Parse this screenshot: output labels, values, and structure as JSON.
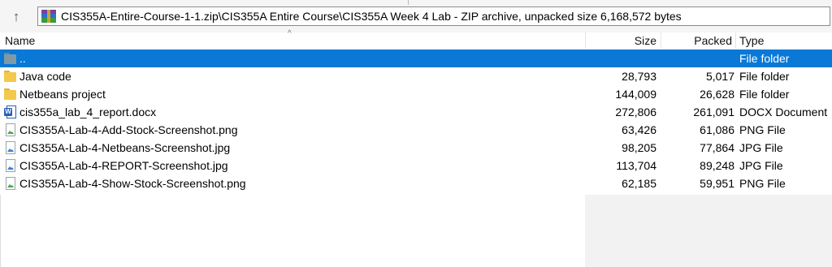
{
  "address": {
    "path": "CIS355A-Entire-Course-1-1.zip\\CIS355A Entire Course\\CIS355A Week 4 Lab - ZIP archive, unpacked size 6,168,572 bytes"
  },
  "toolbar": {
    "up_glyph": "↑"
  },
  "columns": {
    "name": "Name",
    "size": "Size",
    "packed": "Packed",
    "type": "Type"
  },
  "rows": [
    {
      "name": "..",
      "size": "",
      "packed": "",
      "type": "File folder",
      "icon": "up-folder-icon",
      "selected": true
    },
    {
      "name": "Java code",
      "size": "28,793",
      "packed": "5,017",
      "type": "File folder",
      "icon": "folder-icon"
    },
    {
      "name": "Netbeans project",
      "size": "144,009",
      "packed": "26,628",
      "type": "File folder",
      "icon": "folder-icon"
    },
    {
      "name": "cis355a_lab_4_report.docx",
      "size": "272,806",
      "packed": "261,091",
      "type": "DOCX Document",
      "icon": "word-document-icon"
    },
    {
      "name": "CIS355A-Lab-4-Add-Stock-Screenshot.png",
      "size": "63,426",
      "packed": "61,086",
      "type": "PNG File",
      "icon": "png-file-icon"
    },
    {
      "name": "CIS355A-Lab-4-Netbeans-Screenshot.jpg",
      "size": "98,205",
      "packed": "77,864",
      "type": "JPG File",
      "icon": "jpg-file-icon"
    },
    {
      "name": "CIS355A-Lab-4-REPORT-Screenshot.jpg",
      "size": "113,704",
      "packed": "89,248",
      "type": "JPG File",
      "icon": "jpg-file-icon"
    },
    {
      "name": "CIS355A-Lab-4-Show-Stock-Screenshot.png",
      "size": "62,185",
      "packed": "59,951",
      "type": "PNG File",
      "icon": "png-file-icon"
    }
  ],
  "colors": {
    "selection": "#0a78d7",
    "folder": "#f4c84a",
    "word": "#2b5fb7"
  }
}
